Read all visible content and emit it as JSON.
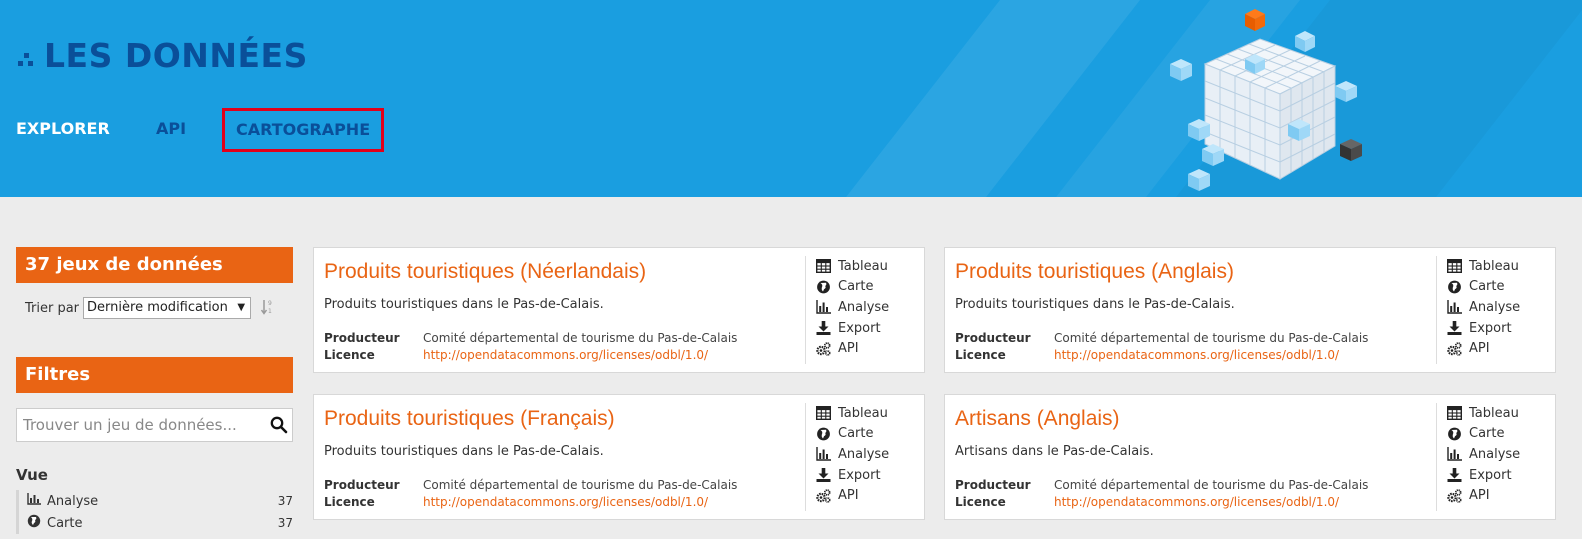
{
  "header": {
    "title": "LES DONNÉES",
    "nav": [
      {
        "label": "EXPLORER",
        "active": true
      },
      {
        "label": "API",
        "active": false
      },
      {
        "label": "CARTOGRAPHE",
        "active": false,
        "highlighted": true
      }
    ]
  },
  "colors": {
    "header_bg": "#1a9ee0",
    "brand_blue": "#0a4f99",
    "accent_orange": "#e96414",
    "highlight_red": "#e2001a"
  },
  "sidebar": {
    "dataset_count": "37 jeux de données",
    "sort_label": "Trier par",
    "sort_value": "Dernière modification",
    "filters_title": "Filtres",
    "search_placeholder": "Trouver un jeu de données...",
    "vue_title": "Vue",
    "vue_items": [
      {
        "label": "Analyse",
        "count": "37",
        "icon": "bar-chart-icon"
      },
      {
        "label": "Carte",
        "count": "37",
        "icon": "globe-icon"
      }
    ]
  },
  "datasets": [
    {
      "title": "Produits touristiques (Néerlandais)",
      "description": "Produits touristiques dans le Pas-de-Calais.",
      "producer_label": "Producteur",
      "producer": "Comité départemental de tourisme du Pas-de-Calais",
      "licence_label": "Licence",
      "licence": "http://opendatacommons.org/licenses/odbl/1.0/"
    },
    {
      "title": "Produits touristiques (Anglais)",
      "description": "Produits touristiques dans le Pas-de-Calais.",
      "producer_label": "Producteur",
      "producer": "Comité départemental de tourisme du Pas-de-Calais",
      "licence_label": "Licence",
      "licence": "http://opendatacommons.org/licenses/odbl/1.0/"
    },
    {
      "title": "Produits touristiques (Français)",
      "description": "Produits touristiques dans le Pas-de-Calais.",
      "producer_label": "Producteur",
      "producer": "Comité départemental de tourisme du Pas-de-Calais",
      "licence_label": "Licence",
      "licence": "http://opendatacommons.org/licenses/odbl/1.0/"
    },
    {
      "title": "Artisans (Anglais)",
      "description": "Artisans dans le Pas-de-Calais.",
      "producer_label": "Producteur",
      "producer": "Comité départemental de tourisme du Pas-de-Calais",
      "licence_label": "Licence",
      "licence": "http://opendatacommons.org/licenses/odbl/1.0/"
    }
  ],
  "actions": [
    {
      "label": "Tableau",
      "icon": "table-icon"
    },
    {
      "label": "Carte",
      "icon": "globe-icon"
    },
    {
      "label": "Analyse",
      "icon": "bar-chart-icon"
    },
    {
      "label": "Export",
      "icon": "download-icon"
    },
    {
      "label": "API",
      "icon": "gears-icon"
    }
  ]
}
